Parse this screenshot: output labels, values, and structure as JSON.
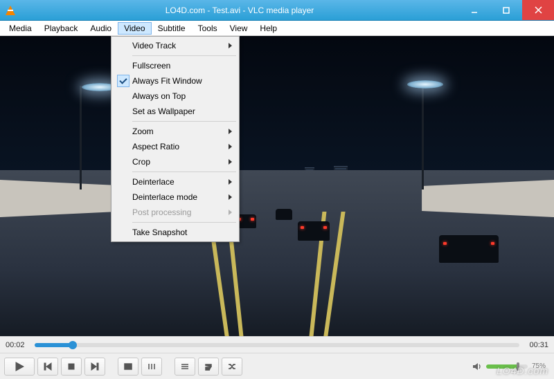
{
  "window": {
    "title": "LO4D.com - Test.avi - VLC media player",
    "watermark": "LO4D.com"
  },
  "menubar": {
    "items": [
      "Media",
      "Playback",
      "Audio",
      "Video",
      "Subtitle",
      "Tools",
      "View",
      "Help"
    ],
    "open_index": 3
  },
  "video_menu": {
    "groups": [
      [
        {
          "label": "Video Track",
          "submenu": true
        }
      ],
      [
        {
          "label": "Fullscreen"
        },
        {
          "label": "Always Fit Window",
          "checked": true
        },
        {
          "label": "Always on Top"
        },
        {
          "label": "Set as Wallpaper"
        }
      ],
      [
        {
          "label": "Zoom",
          "submenu": true
        },
        {
          "label": "Aspect Ratio",
          "submenu": true
        },
        {
          "label": "Crop",
          "submenu": true
        }
      ],
      [
        {
          "label": "Deinterlace",
          "submenu": true
        },
        {
          "label": "Deinterlace mode",
          "submenu": true
        },
        {
          "label": "Post processing",
          "submenu": true,
          "disabled": true
        }
      ],
      [
        {
          "label": "Take Snapshot"
        }
      ]
    ]
  },
  "playback": {
    "current_time": "00:02",
    "total_time": "00:31",
    "progress_percent": 8,
    "volume_percent": 75,
    "volume_label": "75%"
  }
}
